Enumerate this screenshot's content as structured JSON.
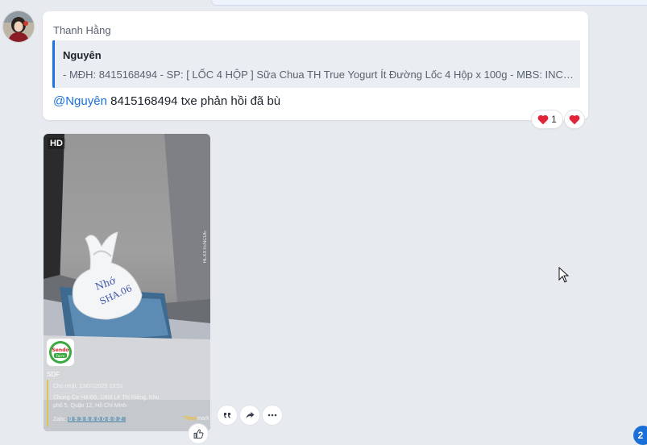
{
  "message": {
    "sender_name": "Thanh Hằng",
    "quote": {
      "author": "Nguyên",
      "text": "- MĐH: 8415168494 - SP: [ LỐC 4 HỘP ] Sữa Chua TH True Yogurt Ít Đường Lốc 4 Hộp x 100g - MBS: INC000..."
    },
    "mention": "@Nguyên",
    "body": " 8415168494 txe phản hồi đã bù",
    "reaction_count": "1"
  },
  "photo": {
    "hd_label": "HD",
    "bag_text_line1": "Nhớ",
    "bag_text_line2": "SHA.06",
    "watermark": {
      "logo_line1": "Sendo",
      "logo_line2": "Farm",
      "label": "SDF",
      "date": "Chủ nhật, 13/07/2025 13:51",
      "address": "Chung Cư Hà Đô, 1303 Lê Thị Riêng, Khu phố 5, Quận 12, Hồ Chí Minh",
      "zalo_label": "Zalo:",
      "zalo_number": "0936800802",
      "brand_prefix": "Time",
      "brand_suffix": "mark",
      "side_code": "HLXXTENCUE"
    }
  },
  "unread_badge": "2",
  "icons": [
    "avatar",
    "heart-icon",
    "quote-icon",
    "share-icon",
    "more-icon",
    "like-icon",
    "cursor"
  ],
  "colors": {
    "background": "#e7eaee",
    "mention": "#1a6fd8",
    "quote_border": "#1a73e8",
    "heart": "#e0243a",
    "badge": "#1a6fd8"
  }
}
